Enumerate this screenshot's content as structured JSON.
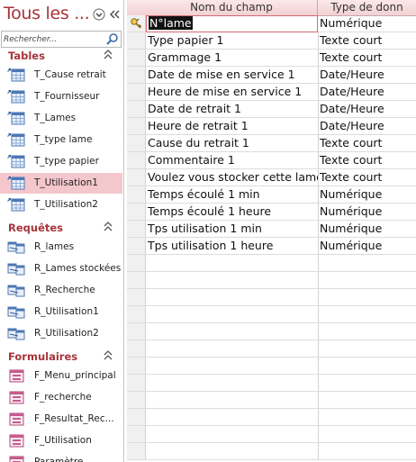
{
  "nav": {
    "title": "Tous les ...",
    "menu_icon": "chevron-down-circle-icon",
    "collapse_icon": "double-chevron-left-icon",
    "search": {
      "placeholder": "Rechercher..."
    },
    "groups": [
      {
        "label": "Tables",
        "items": [
          {
            "label": "T_Cause retrait",
            "icon": "linked-table-icon"
          },
          {
            "label": "T_Fournisseur",
            "icon": "linked-table-icon"
          },
          {
            "label": "T_Lames",
            "icon": "linked-table-icon"
          },
          {
            "label": "T_type lame",
            "icon": "linked-table-icon"
          },
          {
            "label": "T_type papier",
            "icon": "linked-table-icon"
          },
          {
            "label": "T_Utilisation1",
            "icon": "linked-table-icon",
            "selected": true
          },
          {
            "label": "T_Utilisation2",
            "icon": "linked-table-icon"
          }
        ]
      },
      {
        "label": "Requêtes",
        "items": [
          {
            "label": "R_lames",
            "icon": "query-icon"
          },
          {
            "label": "R_Lames stockées",
            "icon": "query-icon"
          },
          {
            "label": "R_Recherche",
            "icon": "query-icon"
          },
          {
            "label": "R_Utilisation1",
            "icon": "query-icon"
          },
          {
            "label": "R_Utilisation2",
            "icon": "query-icon"
          }
        ]
      },
      {
        "label": "Formulaires",
        "items": [
          {
            "label": "F_Menu_principal",
            "icon": "form-icon"
          },
          {
            "label": "F_recherche",
            "icon": "form-icon"
          },
          {
            "label": "F_Resultat_Rec...",
            "icon": "form-icon"
          },
          {
            "label": "F_Utilisation",
            "icon": "form-icon"
          },
          {
            "label": "Paramètre",
            "icon": "form-icon"
          }
        ]
      }
    ]
  },
  "grid": {
    "columns": [
      "Nom du champ",
      "Type de donn"
    ],
    "rows": [
      {
        "name": "N°lame",
        "type": "Numérique",
        "key": true
      },
      {
        "name": "Type papier 1",
        "type": "Texte court"
      },
      {
        "name": "Grammage 1",
        "type": "Texte court"
      },
      {
        "name": "Date de mise en service 1",
        "type": "Date/Heure"
      },
      {
        "name": "Heure de mise en service 1",
        "type": "Date/Heure"
      },
      {
        "name": "Date de retrait 1",
        "type": "Date/Heure"
      },
      {
        "name": "Heure de retrait 1",
        "type": "Date/Heure"
      },
      {
        "name": "Cause du retrait 1",
        "type": "Texte court"
      },
      {
        "name": "Commentaire 1",
        "type": "Texte court"
      },
      {
        "name": "Voulez vous stocker cette lame",
        "type": "Texte court"
      },
      {
        "name": "Temps écoulé 1 min",
        "type": "Numérique"
      },
      {
        "name": "Temps écoulé 1 heure",
        "type": "Numérique"
      },
      {
        "name": "Tps utilisation 1 min",
        "type": "Numérique"
      },
      {
        "name": "Tps utilisation 1 heure",
        "type": "Numérique"
      },
      {
        "name": "",
        "type": ""
      },
      {
        "name": "",
        "type": ""
      },
      {
        "name": "",
        "type": ""
      },
      {
        "name": "",
        "type": ""
      },
      {
        "name": "",
        "type": ""
      },
      {
        "name": "",
        "type": ""
      },
      {
        "name": "",
        "type": ""
      },
      {
        "name": "",
        "type": ""
      },
      {
        "name": "",
        "type": ""
      },
      {
        "name": "",
        "type": ""
      },
      {
        "name": "",
        "type": ""
      },
      {
        "name": "",
        "type": ""
      }
    ],
    "active_row": 0
  },
  "colors": {
    "accent": "#a6343a",
    "selected_bg": "#f4c7cc",
    "header_bg": "#f2d1d3"
  }
}
